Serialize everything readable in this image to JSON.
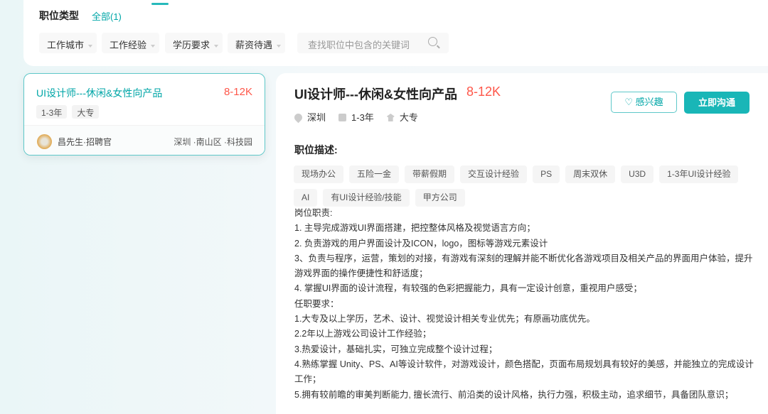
{
  "filters": {
    "type_label": "职位类型",
    "type_all": "全部(1)",
    "dropdowns": [
      "工作城市",
      "工作经验",
      "学历要求",
      "薪资待遇"
    ],
    "search_placeholder": "查找职位中包含的关键词"
  },
  "job_card": {
    "title": "UI设计师---休闲&女性向产品",
    "salary": "8-12K",
    "tags": [
      "1-3年",
      "大专"
    ],
    "recruiter": "昌先生·招聘官",
    "location": "深圳 ·南山区 ·科技园"
  },
  "detail": {
    "title": "UI设计师---休闲&女性向产品",
    "salary": "8-12K",
    "city": "深圳",
    "experience": "1-3年",
    "education": "大专",
    "interest_label": "感兴趣",
    "chat_label": "立即沟通",
    "section_title": "职位描述:",
    "skills": [
      "现场办公",
      "五险一金",
      "带薪假期",
      "交互设计经验",
      "PS",
      "周末双休",
      "U3D",
      "1-3年UI设计经验",
      "AI",
      "有UI设计经验/技能",
      "甲方公司"
    ],
    "description": [
      "岗位职责:",
      "1. 主导完成游戏UI界面搭建，把控整体风格及视觉语言方向；",
      "2. 负责游戏的用户界面设计及ICON，logo，图标等游戏元素设计",
      "3、负责与程序，运营，策划的对接，有游戏有深刻的理解并能不断优化各游戏项目及相关产品的界面用户体验，提升游戏界面的操作便捷性和舒适度；",
      "4. 掌握UI界面的设计流程，有较强的色彩把握能力，具有一定设计创意，重视用户感受；",
      "任职要求：",
      "1.大专及以上学历，艺术、设计、视觉设计相关专业优先；有原画功底优先。",
      "2.2年以上游戏公司设计工作经验；",
      "3.热爱设计，基础扎实，可独立完成整个设计过程；",
      "4.熟练掌握 Unity、PS、AI等设计软件，对游戏设计，颜色搭配，页面布局规划具有较好的美感，并能独立的完成设计工作；",
      "5.拥有较前瞻的审美判断能力, 擅长流行、前沿类的设计风格，执行力强，积极主动，追求细节，具备团队意识；"
    ]
  }
}
